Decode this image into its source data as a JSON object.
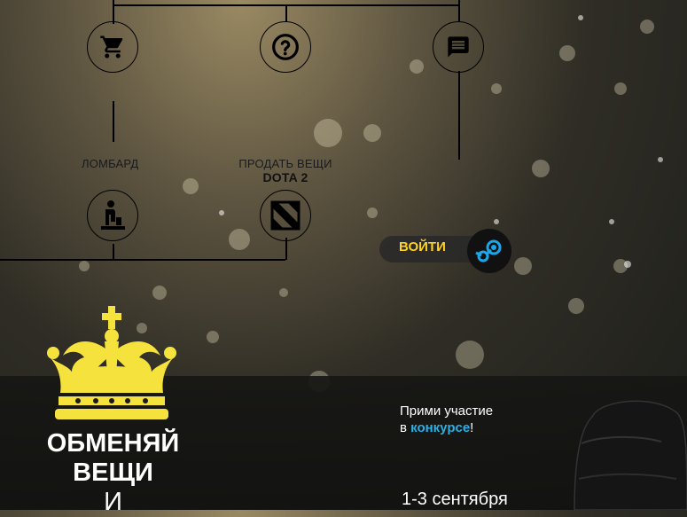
{
  "nav": {
    "pawnshop_label": "ЛОМБАРД",
    "sell_label": "ПРОДАТЬ ВЕЩИ",
    "sell_sub": "DOTA 2"
  },
  "auth": {
    "login_label": "ВОЙТИ"
  },
  "hero": {
    "title_line1": "ОБМЕНЯЙ",
    "title_line2": "ВЕЩИ",
    "title_line3": "И"
  },
  "promo": {
    "text_line1": "Прими участие",
    "text_prefix": "в",
    "link_text": "конкурсе",
    "text_suffix": "!",
    "date": "1-3 сентября"
  },
  "colors": {
    "accent_yellow": "#ffd21f",
    "link_blue": "#27b0e8"
  },
  "icons": [
    "cart-icon",
    "question-icon",
    "chat-icon",
    "pawnshop-icon",
    "dota2-icon",
    "steam-icon",
    "crown-icon"
  ]
}
